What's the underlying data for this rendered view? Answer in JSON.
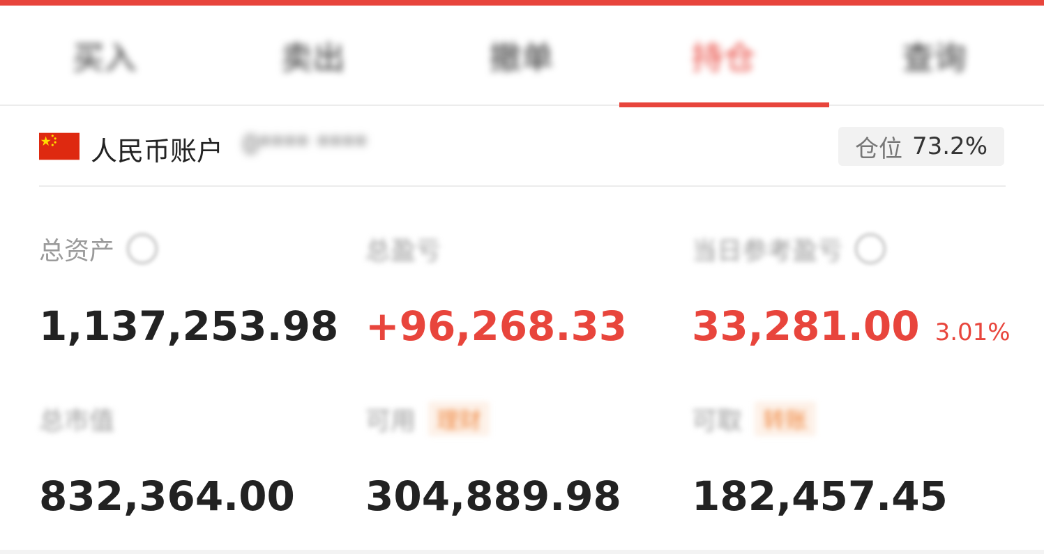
{
  "tabs": [
    {
      "label": "买入"
    },
    {
      "label": "卖出"
    },
    {
      "label": "撤单"
    },
    {
      "label": "持仓"
    },
    {
      "label": "查询"
    }
  ],
  "account": {
    "name": "人民币账户",
    "id": "0**** ****",
    "position_label": "仓位",
    "position_value": "73.2%"
  },
  "stats": {
    "total_assets": {
      "label": "总资产",
      "value": "1,137,253.98"
    },
    "total_pnl": {
      "label": "总盈亏",
      "value": "+96,268.33"
    },
    "today_pnl": {
      "label": "当日参考盈亏",
      "value": "33,281.00",
      "percent": "3.01%"
    },
    "market_value": {
      "label": "总市值",
      "value": "832,364.00"
    },
    "available": {
      "label": "可用",
      "tag": "理财",
      "value": "304,889.98"
    },
    "withdrawable": {
      "label": "可取",
      "tag": "转账",
      "value": "182,457.45"
    }
  },
  "colors": {
    "accent": "#e8453c",
    "tag": "#f08a44",
    "label": "#9a9a9a"
  }
}
